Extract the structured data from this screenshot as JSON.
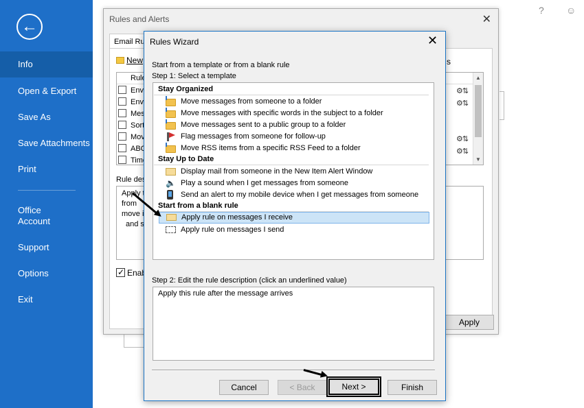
{
  "backstage": {
    "back_icon": "back-arrow-icon",
    "items": [
      "Info",
      "Open & Export",
      "Save As",
      "Save Attachments",
      "Print",
      "Office Account",
      "Support",
      "Options",
      "Exit"
    ],
    "top_right": [
      "?",
      "☺"
    ]
  },
  "rules_alerts": {
    "title": "Rules and Alerts",
    "tab_label": "Email Ru",
    "new_label": "New",
    "s_tab": "s",
    "col_rule": "Rule",
    "rows": [
      "Enva",
      "Enva",
      "Mess",
      "Sort",
      "Mov",
      "ABC",
      "Timo"
    ],
    "desc_label": "Rule des",
    "desc_lines": [
      "Apply t",
      "from",
      "move it",
      "and s"
    ],
    "enable_label": "Enab",
    "apply_label": "Apply"
  },
  "wizard": {
    "title": "Rules Wizard",
    "intro": "Start from a template or from a blank rule",
    "step1": "Step 1: Select a template",
    "groups": {
      "organized": "Stay Organized",
      "uptodate": "Stay Up to Date",
      "blank": "Start from a blank rule"
    },
    "templates": {
      "move_from": "Move messages from someone to a folder",
      "move_words": "Move messages with specific words in the subject to a folder",
      "move_group": "Move messages sent to a public group to a folder",
      "flag": "Flag messages from someone for follow-up",
      "rss": "Move RSS items from a specific RSS Feed to a folder",
      "display": "Display mail from someone in the New Item Alert Window",
      "sound": "Play a sound when I get messages from someone",
      "alert": "Send an alert to my mobile device when I get messages from someone",
      "receive": "Apply rule on messages I receive",
      "send": "Apply rule on messages I send"
    },
    "selected_template": "Apply rule on messages I receive",
    "step2": "Step 2: Edit the rule description (click an underlined value)",
    "description": "Apply this rule after the message arrives",
    "buttons": {
      "cancel": "Cancel",
      "back": "< Back",
      "next": "Next >",
      "finish": "Finish"
    }
  }
}
